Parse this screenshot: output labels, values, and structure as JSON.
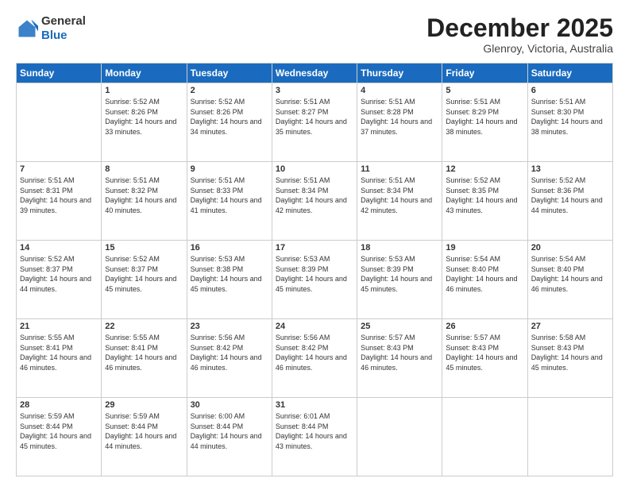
{
  "logo": {
    "general": "General",
    "blue": "Blue"
  },
  "header": {
    "month": "December 2025",
    "location": "Glenroy, Victoria, Australia"
  },
  "days": [
    "Sunday",
    "Monday",
    "Tuesday",
    "Wednesday",
    "Thursday",
    "Friday",
    "Saturday"
  ],
  "weeks": [
    [
      {
        "num": "",
        "sunrise": "",
        "sunset": "",
        "daylight": ""
      },
      {
        "num": "1",
        "sunrise": "Sunrise: 5:52 AM",
        "sunset": "Sunset: 8:26 PM",
        "daylight": "Daylight: 14 hours and 33 minutes."
      },
      {
        "num": "2",
        "sunrise": "Sunrise: 5:52 AM",
        "sunset": "Sunset: 8:26 PM",
        "daylight": "Daylight: 14 hours and 34 minutes."
      },
      {
        "num": "3",
        "sunrise": "Sunrise: 5:51 AM",
        "sunset": "Sunset: 8:27 PM",
        "daylight": "Daylight: 14 hours and 35 minutes."
      },
      {
        "num": "4",
        "sunrise": "Sunrise: 5:51 AM",
        "sunset": "Sunset: 8:28 PM",
        "daylight": "Daylight: 14 hours and 37 minutes."
      },
      {
        "num": "5",
        "sunrise": "Sunrise: 5:51 AM",
        "sunset": "Sunset: 8:29 PM",
        "daylight": "Daylight: 14 hours and 38 minutes."
      },
      {
        "num": "6",
        "sunrise": "Sunrise: 5:51 AM",
        "sunset": "Sunset: 8:30 PM",
        "daylight": "Daylight: 14 hours and 38 minutes."
      }
    ],
    [
      {
        "num": "7",
        "sunrise": "Sunrise: 5:51 AM",
        "sunset": "Sunset: 8:31 PM",
        "daylight": "Daylight: 14 hours and 39 minutes."
      },
      {
        "num": "8",
        "sunrise": "Sunrise: 5:51 AM",
        "sunset": "Sunset: 8:32 PM",
        "daylight": "Daylight: 14 hours and 40 minutes."
      },
      {
        "num": "9",
        "sunrise": "Sunrise: 5:51 AM",
        "sunset": "Sunset: 8:33 PM",
        "daylight": "Daylight: 14 hours and 41 minutes."
      },
      {
        "num": "10",
        "sunrise": "Sunrise: 5:51 AM",
        "sunset": "Sunset: 8:34 PM",
        "daylight": "Daylight: 14 hours and 42 minutes."
      },
      {
        "num": "11",
        "sunrise": "Sunrise: 5:51 AM",
        "sunset": "Sunset: 8:34 PM",
        "daylight": "Daylight: 14 hours and 42 minutes."
      },
      {
        "num": "12",
        "sunrise": "Sunrise: 5:52 AM",
        "sunset": "Sunset: 8:35 PM",
        "daylight": "Daylight: 14 hours and 43 minutes."
      },
      {
        "num": "13",
        "sunrise": "Sunrise: 5:52 AM",
        "sunset": "Sunset: 8:36 PM",
        "daylight": "Daylight: 14 hours and 44 minutes."
      }
    ],
    [
      {
        "num": "14",
        "sunrise": "Sunrise: 5:52 AM",
        "sunset": "Sunset: 8:37 PM",
        "daylight": "Daylight: 14 hours and 44 minutes."
      },
      {
        "num": "15",
        "sunrise": "Sunrise: 5:52 AM",
        "sunset": "Sunset: 8:37 PM",
        "daylight": "Daylight: 14 hours and 45 minutes."
      },
      {
        "num": "16",
        "sunrise": "Sunrise: 5:53 AM",
        "sunset": "Sunset: 8:38 PM",
        "daylight": "Daylight: 14 hours and 45 minutes."
      },
      {
        "num": "17",
        "sunrise": "Sunrise: 5:53 AM",
        "sunset": "Sunset: 8:39 PM",
        "daylight": "Daylight: 14 hours and 45 minutes."
      },
      {
        "num": "18",
        "sunrise": "Sunrise: 5:53 AM",
        "sunset": "Sunset: 8:39 PM",
        "daylight": "Daylight: 14 hours and 45 minutes."
      },
      {
        "num": "19",
        "sunrise": "Sunrise: 5:54 AM",
        "sunset": "Sunset: 8:40 PM",
        "daylight": "Daylight: 14 hours and 46 minutes."
      },
      {
        "num": "20",
        "sunrise": "Sunrise: 5:54 AM",
        "sunset": "Sunset: 8:40 PM",
        "daylight": "Daylight: 14 hours and 46 minutes."
      }
    ],
    [
      {
        "num": "21",
        "sunrise": "Sunrise: 5:55 AM",
        "sunset": "Sunset: 8:41 PM",
        "daylight": "Daylight: 14 hours and 46 minutes."
      },
      {
        "num": "22",
        "sunrise": "Sunrise: 5:55 AM",
        "sunset": "Sunset: 8:41 PM",
        "daylight": "Daylight: 14 hours and 46 minutes."
      },
      {
        "num": "23",
        "sunrise": "Sunrise: 5:56 AM",
        "sunset": "Sunset: 8:42 PM",
        "daylight": "Daylight: 14 hours and 46 minutes."
      },
      {
        "num": "24",
        "sunrise": "Sunrise: 5:56 AM",
        "sunset": "Sunset: 8:42 PM",
        "daylight": "Daylight: 14 hours and 46 minutes."
      },
      {
        "num": "25",
        "sunrise": "Sunrise: 5:57 AM",
        "sunset": "Sunset: 8:43 PM",
        "daylight": "Daylight: 14 hours and 46 minutes."
      },
      {
        "num": "26",
        "sunrise": "Sunrise: 5:57 AM",
        "sunset": "Sunset: 8:43 PM",
        "daylight": "Daylight: 14 hours and 45 minutes."
      },
      {
        "num": "27",
        "sunrise": "Sunrise: 5:58 AM",
        "sunset": "Sunset: 8:43 PM",
        "daylight": "Daylight: 14 hours and 45 minutes."
      }
    ],
    [
      {
        "num": "28",
        "sunrise": "Sunrise: 5:59 AM",
        "sunset": "Sunset: 8:44 PM",
        "daylight": "Daylight: 14 hours and 45 minutes."
      },
      {
        "num": "29",
        "sunrise": "Sunrise: 5:59 AM",
        "sunset": "Sunset: 8:44 PM",
        "daylight": "Daylight: 14 hours and 44 minutes."
      },
      {
        "num": "30",
        "sunrise": "Sunrise: 6:00 AM",
        "sunset": "Sunset: 8:44 PM",
        "daylight": "Daylight: 14 hours and 44 minutes."
      },
      {
        "num": "31",
        "sunrise": "Sunrise: 6:01 AM",
        "sunset": "Sunset: 8:44 PM",
        "daylight": "Daylight: 14 hours and 43 minutes."
      },
      {
        "num": "",
        "sunrise": "",
        "sunset": "",
        "daylight": ""
      },
      {
        "num": "",
        "sunrise": "",
        "sunset": "",
        "daylight": ""
      },
      {
        "num": "",
        "sunrise": "",
        "sunset": "",
        "daylight": ""
      }
    ]
  ]
}
